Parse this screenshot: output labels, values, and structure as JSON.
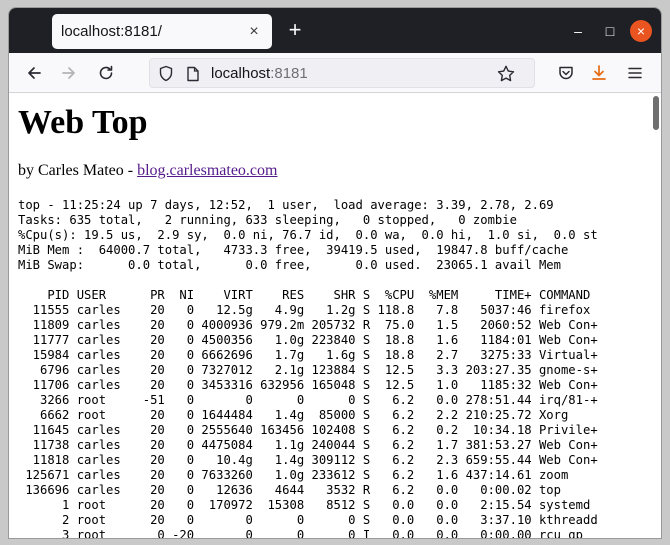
{
  "browser": {
    "tab_title": "localhost:8181/",
    "tab_close": "×",
    "new_tab": "+",
    "url_host": "localhost",
    "url_port": ":8181",
    "window_buttons": {
      "minimize": "–",
      "maximize": "□",
      "close": "×"
    }
  },
  "page": {
    "title": "Web Top",
    "byline_prefix": "by Carles Mateo - ",
    "byline_link": "blog.carlesmateo.com"
  },
  "top_summary": [
    "top - 11:25:24 up 7 days, 12:52,  1 user,  load average: 3.39, 2.78, 2.69",
    "Tasks: 635 total,   2 running, 633 sleeping,   0 stopped,   0 zombie",
    "%Cpu(s): 19.5 us,  2.9 sy,  0.0 ni, 76.7 id,  0.0 wa,  0.0 hi,  1.0 si,  0.0 st",
    "MiB Mem :  64000.7 total,   4733.3 free,  39419.5 used,  19847.8 buff/cache",
    "MiB Swap:      0.0 total,      0.0 free,      0.0 used.  23065.1 avail Mem"
  ],
  "process_table": {
    "header": "    PID USER      PR  NI    VIRT    RES    SHR S  %CPU  %MEM     TIME+ COMMAND",
    "rows": [
      "  11555 carles    20   0   12.5g   4.9g   1.2g S 118.8   7.8   5037:46 firefox",
      "  11809 carles    20   0 4000936 979.2m 205732 R  75.0   1.5   2060:52 Web Con+",
      "  11777 carles    20   0 4500356   1.0g 223840 S  18.8   1.6   1184:01 Web Con+",
      "  15984 carles    20   0 6662696   1.7g   1.6g S  18.8   2.7   3275:33 Virtual+",
      "   6796 carles    20   0 7327012   2.1g 123884 S  12.5   3.3 203:27.35 gnome-s+",
      "  11706 carles    20   0 3453316 632956 165048 S  12.5   1.0   1185:32 Web Con+",
      "   3266 root     -51   0       0      0      0 S   6.2   0.0 278:51.44 irq/81-+",
      "   6662 root      20   0 1644484   1.4g  85000 S   6.2   2.2 210:25.72 Xorg",
      "  11645 carles    20   0 2555640 163456 102408 S   6.2   0.2  10:34.18 Privile+",
      "  11738 carles    20   0 4475084   1.1g 240044 S   6.2   1.7 381:53.27 Web Con+",
      "  11818 carles    20   0   10.4g   1.4g 309112 S   6.2   2.3 659:55.44 Web Con+",
      " 125671 carles    20   0 7633260   1.0g 233612 S   6.2   1.6 437:14.61 zoom",
      " 136696 carles    20   0   12636   4644   3532 R   6.2   0.0   0:00.02 top",
      "      1 root      20   0  170972  15308   8512 S   0.0   0.0   2:15.54 systemd",
      "      2 root      20   0       0      0      0 S   0.0   0.0   3:37.10 kthreadd",
      "      3 root       0 -20       0      0      0 I   0.0   0.0   0:00.00 rcu_gp"
    ]
  },
  "colors": {
    "titlebar": "#1f1f26",
    "toolbar": "#f9f9fb",
    "close_button": "#e95420",
    "download_icon": "#e66b14",
    "visited_link": "#551a8b"
  },
  "icons": {
    "back": "arrow-left-icon",
    "forward": "arrow-right-icon",
    "reload": "reload-icon",
    "shield": "shield-icon",
    "page": "page-icon",
    "star": "star-icon",
    "pocket": "pocket-icon",
    "download": "download-icon",
    "menu": "hamburger-menu-icon"
  }
}
